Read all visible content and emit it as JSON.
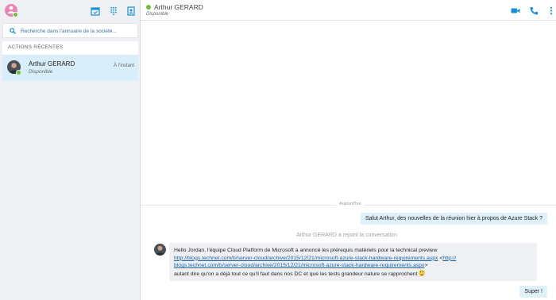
{
  "sidebar": {
    "search": {
      "placeholder": "Recherche dans l'annuaire de la société..."
    },
    "recent_section_title": "ACTIONS RÉCENTES",
    "contacts": [
      {
        "name": "Arthur GERARD",
        "status": "Disponible",
        "time": "À l'instant"
      }
    ],
    "icons": [
      "user-avatar-icon",
      "calendar-icon",
      "dialpad-icon",
      "contacts-book-icon"
    ]
  },
  "chat": {
    "header": {
      "name": "Arthur GERARD",
      "status": "Disponible"
    },
    "day_separator": "Aujourd'hui",
    "messages": [
      {
        "type": "outgoing",
        "text": "Salut Arthur, des nouvelles de la réunion hier à propos de Azure Stack ?"
      },
      {
        "type": "system",
        "text": "Arthur GERARD a rejoint la conversation"
      },
      {
        "type": "incoming",
        "line1": "Hello Jordan, l'équipe Cloud Platform de Microsoft a annoncé les prérequis matériels pour la technical preview",
        "link": "http://blogs.technet.com/b/server-cloud/archive/2015/12/21/microsoft-azure-stack-hardware-requirements.aspx",
        "link_wrapped_a": "http://",
        "link_wrapped_b": "blogs.technet.com/b/server-cloud/archive/2015/12/21/microsoft-azure-stack-hardware-requirements.aspx",
        "line3": "autant dire qu'on a déjà tout ce qu'il faut dans nos DC et que les tests grandeur nature se rapprochent"
      },
      {
        "type": "outgoing",
        "text": "Super !"
      }
    ],
    "header_icons": [
      "video-call-icon",
      "phone-call-icon",
      "more-options-icon"
    ]
  },
  "colors": {
    "presence_available": "#6dbe3d",
    "accent": "#1a8fd6",
    "outgoing_bubble": "#dff1fb",
    "incoming_bubble": "#eef0f3",
    "selected_row": "#d8eefa"
  }
}
